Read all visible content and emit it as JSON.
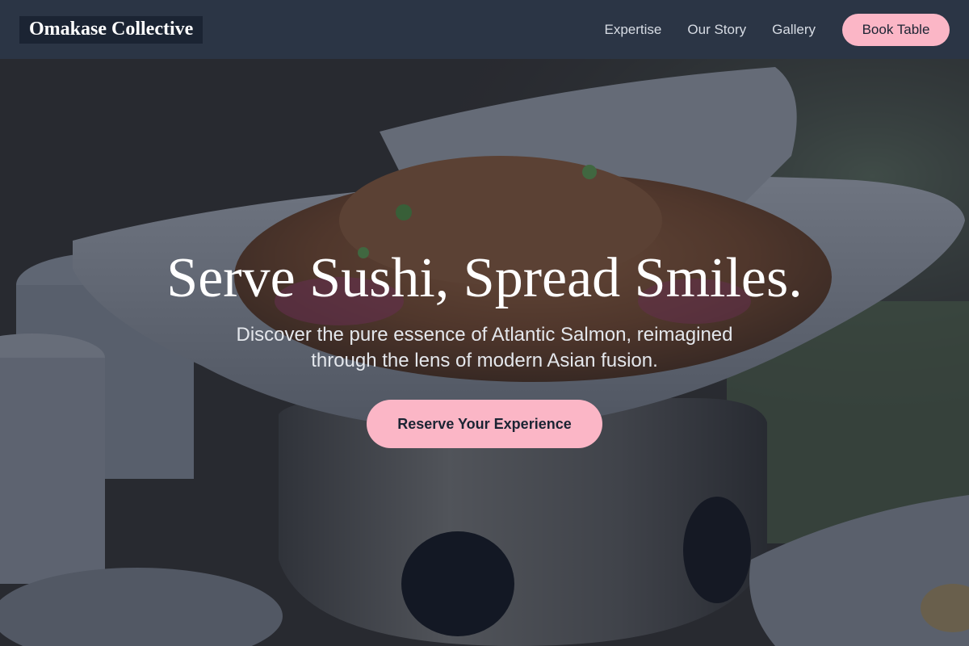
{
  "nav": {
    "logo": "Omakase Collective",
    "links": [
      "Expertise",
      "Our Story",
      "Gallery"
    ],
    "cta": "Book Table"
  },
  "hero": {
    "title": "Serve Sushi, Spread Smiles.",
    "subtitle": "Discover the pure essence of Atlantic Salmon, reimagined through the lens of modern Asian fusion.",
    "cta": "Reserve Your Experience",
    "background_image": "dish-photo"
  },
  "colors": {
    "nav_bg": "#2b3545",
    "accent": "#fbb6c6",
    "text_light": "#ffffff",
    "overlay": "#161e30"
  }
}
